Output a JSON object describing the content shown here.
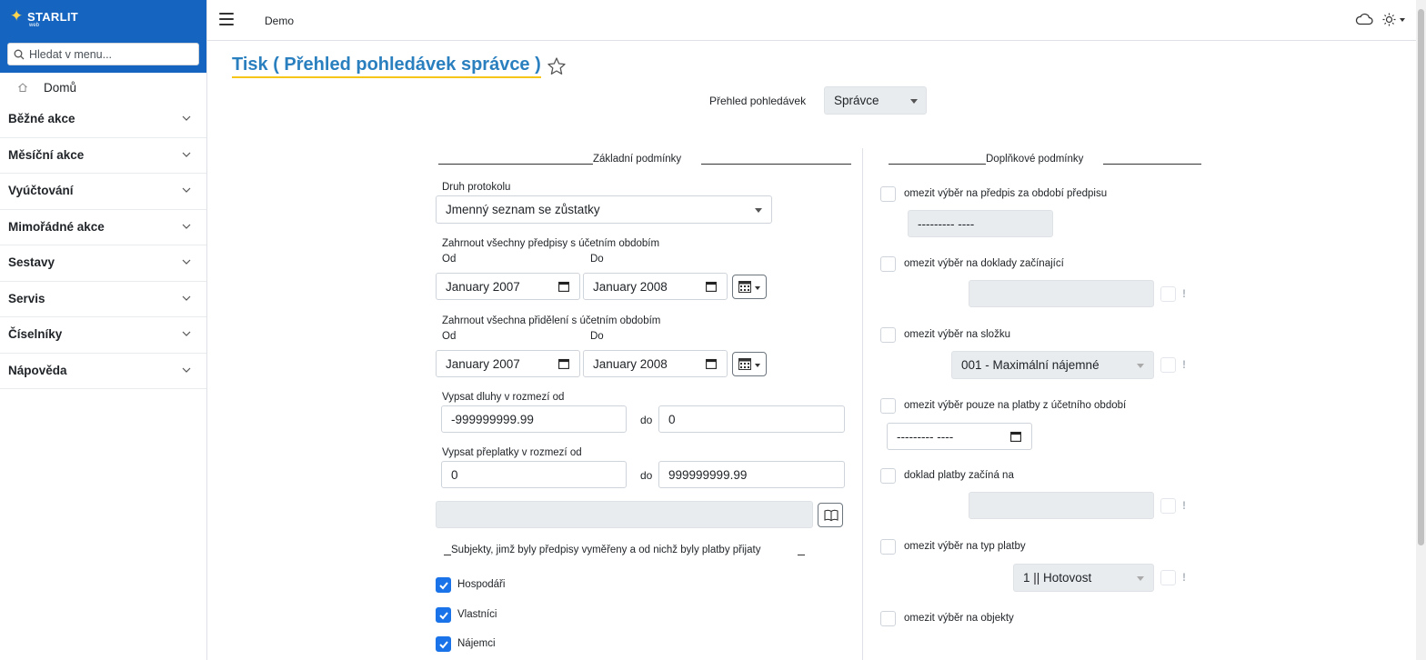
{
  "brand": {
    "name": "STARLIT",
    "sub": "web"
  },
  "search": {
    "placeholder": "Hledat v menu..."
  },
  "sidebar": {
    "home": "Domů",
    "items": [
      {
        "label": "Běžné akce"
      },
      {
        "label": "Měsíční akce"
      },
      {
        "label": "Vyúčtování"
      },
      {
        "label": "Mimořádné akce"
      },
      {
        "label": "Sestavy"
      },
      {
        "label": "Servis"
      },
      {
        "label": "Číselníky"
      },
      {
        "label": "Nápověda"
      }
    ]
  },
  "topbar": {
    "label": "Demo"
  },
  "page": {
    "title": "Tisk ( Přehled pohledávek správce )",
    "overview_label": "Přehled pohledávek",
    "overview_value": "Správce"
  },
  "basic": {
    "heading": "Základní podmínky",
    "protocol_label": "Druh protokolu",
    "protocol_value": "Jmenný seznam se zůstatky",
    "prescriptions_label": "Zahrnout všechny předpisy s účetním obdobím",
    "from_label": "Od",
    "to_label": "Do",
    "prescriptions_from": "January 2007",
    "prescriptions_to": "January 2008",
    "allocations_label": "Zahrnout všechna přidělení s účetním obdobím",
    "allocations_from": "January 2007",
    "allocations_to": "January 2008",
    "debts_label": "Vypsat dluhy v rozmezí od",
    "debts_from": "-999999999.99",
    "debts_to": "0",
    "overpay_label": "Vypsat přeplatky v rozmezí od",
    "overpay_from": "0",
    "overpay_to": "999999999.99",
    "do_label": "do",
    "subjects_heading": "Subjekty, jimž byly předpisy vyměřeny a od nichž byly platby přijaty",
    "subjects": [
      {
        "label": "Hospodáři",
        "checked": true
      },
      {
        "label": "Vlastníci",
        "checked": true
      },
      {
        "label": "Nájemci",
        "checked": true
      }
    ]
  },
  "extra": {
    "heading": "Doplňkové podmínky",
    "period_label": "omezit výběr na předpis za období předpisu",
    "period_value": "--------- ----",
    "docs_label": "omezit výběr na doklady začínající",
    "folder_label": "omezit výběr na složku",
    "folder_value": "001 - Maximální nájemné",
    "payments_label": "omezit výběr pouze na platby z účetního období",
    "payments_value": "--------- ----",
    "paydoc_label": "doklad platby začíná na",
    "paytype_label": "omezit výběr na typ platby",
    "paytype_value": "1 || Hotovost",
    "objects_label": "omezit výběr na objekty",
    "excl": "!"
  },
  "colors": {
    "brand": "#1565c0",
    "title": "#2a7fbf",
    "accent": "#1a73e8",
    "underline": "#f5c518"
  },
  "icons": [
    "search-icon",
    "home-icon",
    "chevron-down-icon",
    "hamburger-icon",
    "cloud-icon",
    "sun-icon",
    "star-icon",
    "calendar-icon",
    "book-icon",
    "check-icon"
  ]
}
